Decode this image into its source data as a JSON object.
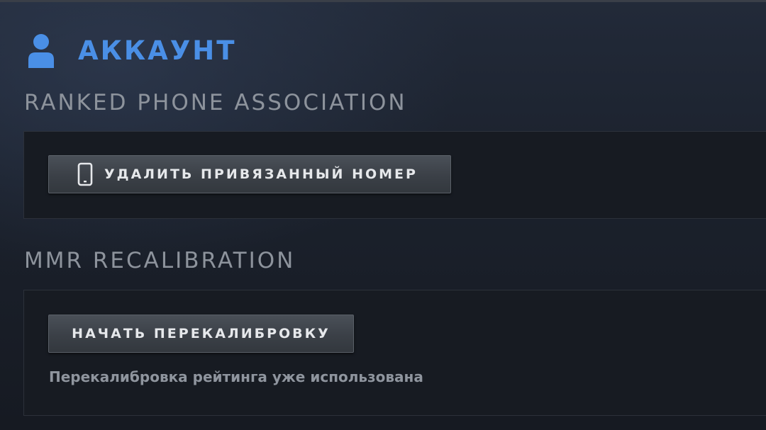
{
  "header": {
    "title": "АККАУНТ",
    "icon": "user-icon",
    "accent_color": "#4a8fe6"
  },
  "sections": [
    {
      "title": "RANKED PHONE ASSOCIATION",
      "button": {
        "label": "УДАЛИТЬ ПРИВЯЗАННЫЙ НОМЕР",
        "icon": "phone-icon"
      }
    },
    {
      "title": "MMR RECALIBRATION",
      "button": {
        "label": "НАЧАТЬ ПЕРЕКАЛИБРОВКУ"
      },
      "note": "Перекалибровка рейтинга уже использована"
    }
  ]
}
